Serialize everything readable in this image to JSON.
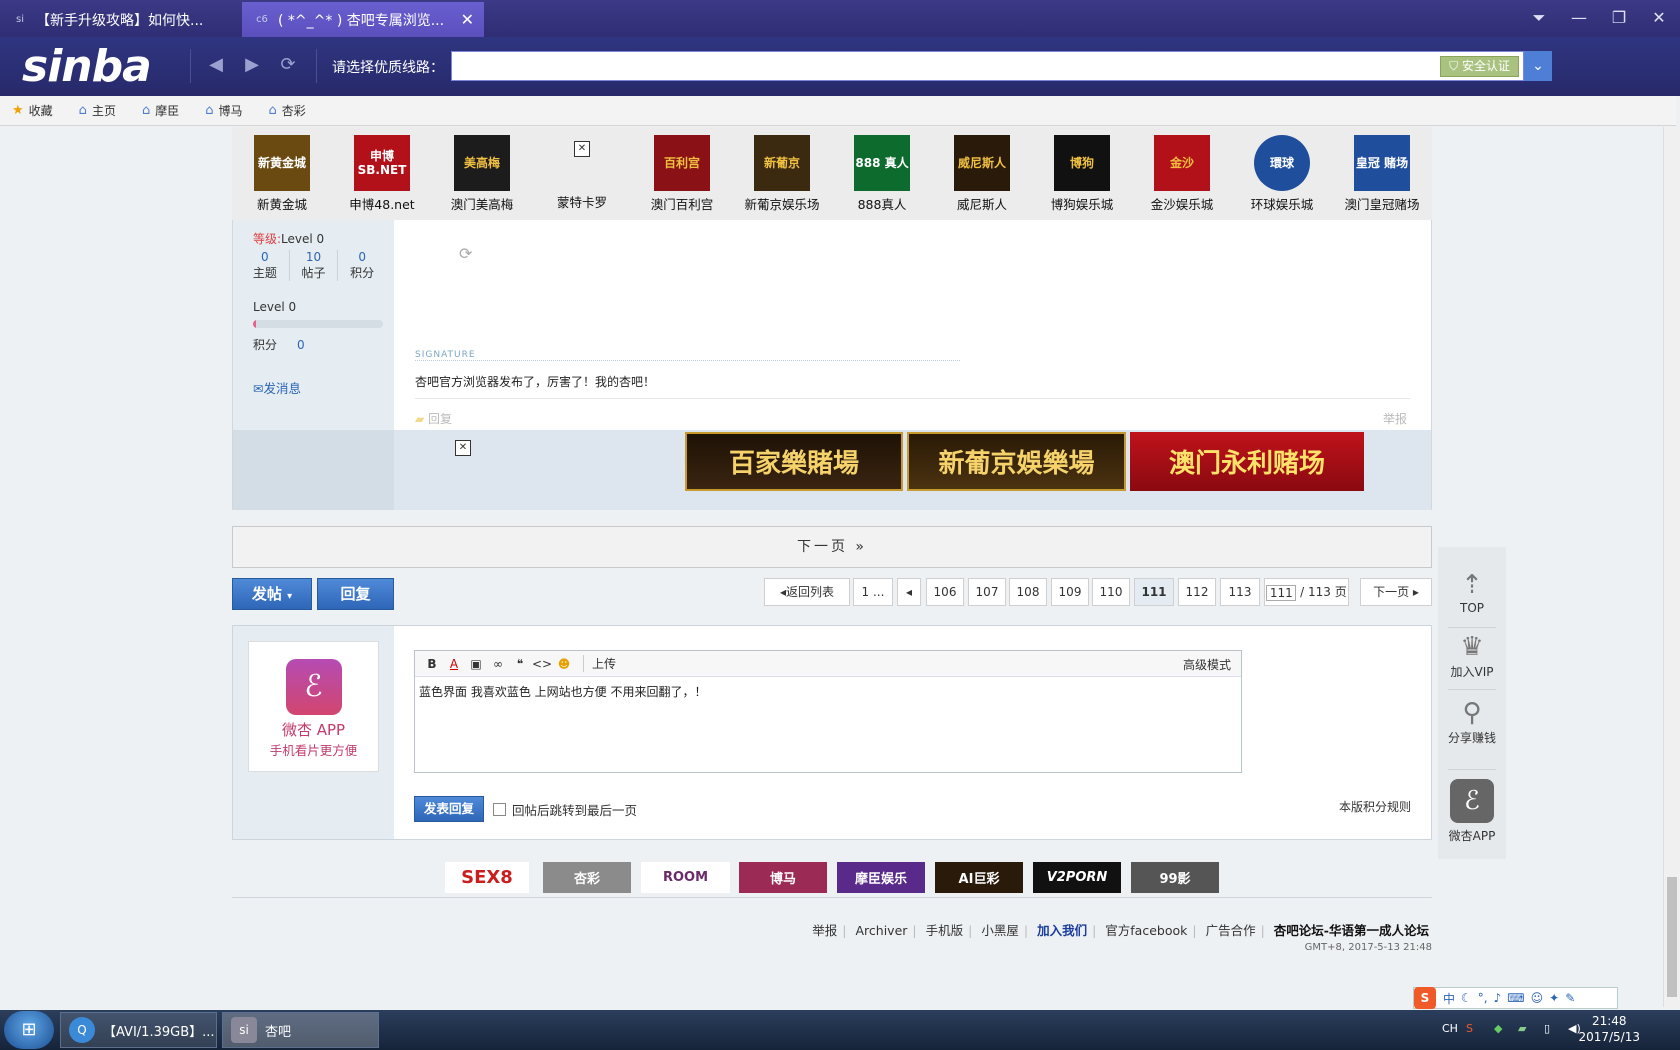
{
  "browser": {
    "tabs": [
      {
        "icon": "sinba-icon",
        "label": "【新手升级攻略】如何快..."
      },
      {
        "icon": "xingba-icon",
        "label": "( *^_^* ) 杏吧专属浏览..."
      }
    ],
    "logo": "sinba",
    "address_label": "请选择优质线路：",
    "address_value": "",
    "secure_label": "安全认证",
    "favorites": [
      {
        "label": "收藏",
        "icon": "star-icon"
      },
      {
        "label": "主页",
        "icon": "home-icon"
      },
      {
        "label": "摩臣",
        "icon": "home-icon"
      },
      {
        "label": "博马",
        "icon": "home-icon"
      },
      {
        "label": "杏彩",
        "icon": "home-icon"
      }
    ]
  },
  "casinos": [
    {
      "name": "新黄金城",
      "logo_text": "新黄金城",
      "color": "#6b4a12"
    },
    {
      "name": "申博48.net",
      "logo_text": "申博 SB.NET",
      "color": "#b3111a"
    },
    {
      "name": "澳门美高梅",
      "logo_text": "美高梅",
      "color": "#1c1c1c"
    },
    {
      "name": "蒙特卡罗",
      "logo_text": "",
      "color": ""
    },
    {
      "name": "澳门百利宫",
      "logo_text": "百利宫",
      "color": "#8a1216"
    },
    {
      "name": "新葡京娱乐场",
      "logo_text": "新葡京",
      "color": "#3b2a10"
    },
    {
      "name": "888真人",
      "logo_text": "888 真人",
      "color": "#0e6b2e"
    },
    {
      "name": "威尼斯人",
      "logo_text": "威尼斯人",
      "color": "#2a1a0a"
    },
    {
      "name": "博狗娱乐城",
      "logo_text": "博狗",
      "color": "#111111"
    },
    {
      "name": "金沙娱乐城",
      "logo_text": "金沙",
      "color": "#b3111a"
    },
    {
      "name": "环球娱乐城",
      "logo_text": "環球",
      "color": "#1f4f9c"
    },
    {
      "name": "澳门皇冠赌场",
      "logo_text": "皇冠 赌场",
      "color": "#1f4f9c"
    }
  ],
  "post": {
    "level_key": "等级:",
    "level_value": "Level 0",
    "stats": [
      {
        "value": "0",
        "label": "主题"
      },
      {
        "value": "10",
        "label": "帖子"
      },
      {
        "value": "0",
        "label": "积分"
      }
    ],
    "level2": "Level 0",
    "level_progress": 0.02,
    "points_label": "积分",
    "points_value": "0",
    "message_link": "发消息",
    "signature_label": "SIGNATURE",
    "signature_text": "杏吧官方浏览器发布了，厉害了！我的杏吧！",
    "reply_link": "回复",
    "report_link": "举报",
    "banners": [
      "百家樂賭場",
      "新葡京娛樂場",
      "澳门永利赌场"
    ]
  },
  "next_page": "下一页 »",
  "actions": {
    "post_label": "发帖",
    "reply_label": "回复"
  },
  "pagination": {
    "back": "返回列表",
    "first": "1 ...",
    "pages": [
      "106",
      "107",
      "108",
      "109",
      "110",
      "111",
      "112",
      "113"
    ],
    "current": "111",
    "input_value": "111",
    "total": "/ 113 页",
    "next": "下一页"
  },
  "reply": {
    "app_title": "微杏 APP",
    "app_subtitle": "手机看片更方便",
    "toolbar": {
      "bold": "B",
      "upload": "上传",
      "advanced": "高级模式"
    },
    "content": "蓝色界面 我喜欢蓝色  上网站也方便 不用来回翻了，！",
    "submit": "发表回复",
    "checkbox_label": "回帖后跳转到最后一页",
    "rules_link": "本版积分规则"
  },
  "partners": [
    {
      "name": "SEX8",
      "color": "#c81e1e",
      "bg": "#ffffff"
    },
    {
      "name": "杏彩",
      "color": "#ffffff",
      "bg": "#8b8b8b"
    },
    {
      "name": "ROOM",
      "color": "#6a2a6a",
      "bg": "#ffffff"
    },
    {
      "name": "博马",
      "color": "#ffffff",
      "bg": "#9b2a55"
    },
    {
      "name": "摩臣娱乐",
      "color": "#ffffff",
      "bg": "#5a2a8a"
    },
    {
      "name": "AI巨彩",
      "color": "#ffffff",
      "bg": "#2a1a0a"
    },
    {
      "name": "V2PORN",
      "color": "#ffffff",
      "bg": "#111111"
    },
    {
      "name": "99影",
      "color": "#ffffff",
      "bg": "#555555"
    }
  ],
  "footer": {
    "links": [
      "举报",
      "Archiver",
      "手机版",
      "小黑屋",
      "加入我们",
      "官方facebook",
      "广告合作",
      "杏吧论坛-华语第一成人论坛"
    ],
    "time": "GMT+8, 2017-5-13 21:48"
  },
  "float_panel": [
    {
      "label": "TOP",
      "icon": "arrow-up-icon"
    },
    {
      "label": "加入VIP",
      "icon": "crown-icon"
    },
    {
      "label": "分享赚钱",
      "icon": "money-bag-icon"
    },
    {
      "label": "微杏APP",
      "icon": "app-icon"
    }
  ],
  "taskbar": {
    "tasks": [
      {
        "label": "【AVI/1.39GB】..."
      },
      {
        "label": "杏吧"
      }
    ],
    "lang": "CH",
    "ime_label": "中",
    "time": "21:48",
    "date": "2017/5/13"
  }
}
